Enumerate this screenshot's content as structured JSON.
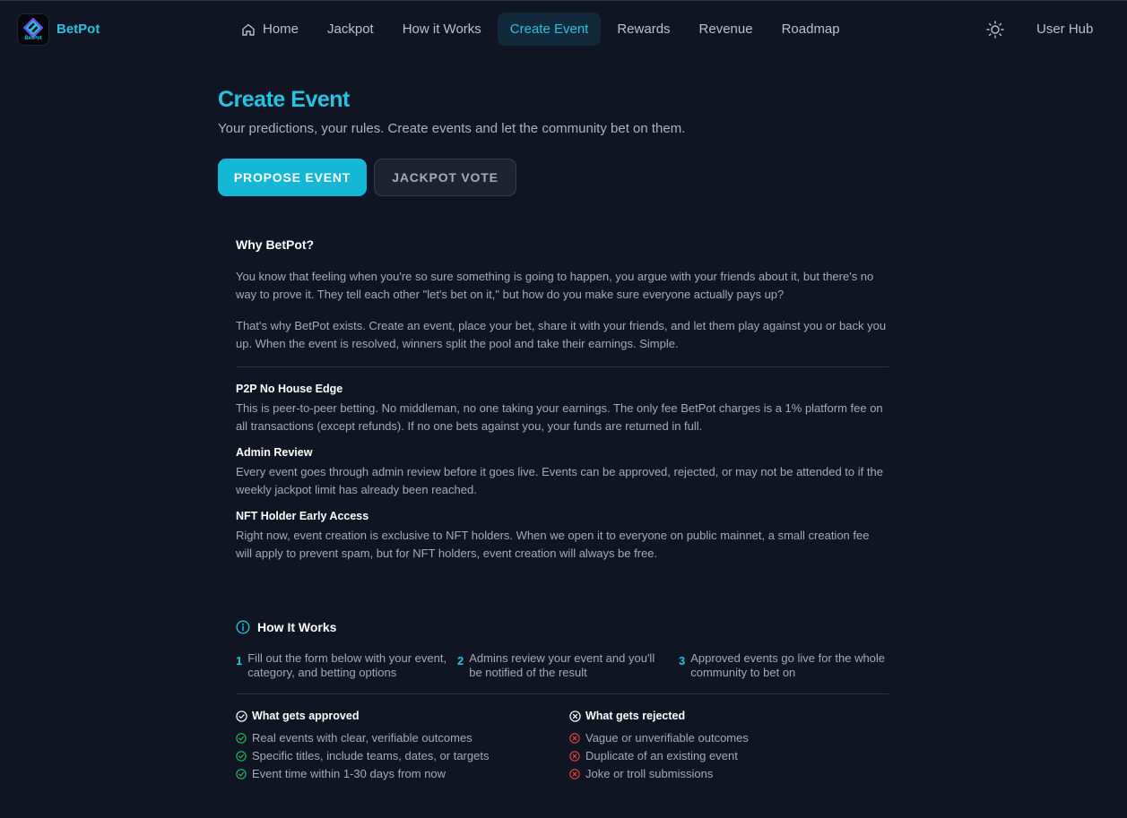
{
  "brand": {
    "name": "BetPot",
    "logo_text": "BetPot"
  },
  "nav": {
    "items": [
      {
        "label": "Home",
        "icon": "home-icon"
      },
      {
        "label": "Jackpot"
      },
      {
        "label": "How it Works"
      },
      {
        "label": "Create Event",
        "active": true
      },
      {
        "label": "Rewards"
      },
      {
        "label": "Revenue"
      },
      {
        "label": "Roadmap"
      }
    ],
    "theme_icon": "sun-icon",
    "user_hub": "User Hub"
  },
  "page": {
    "title": "Create Event",
    "subtitle": "Your predictions, your rules. Create events and let the community bet on them."
  },
  "actions": {
    "propose": "PROPOSE EVENT",
    "jackpot_vote": "JACKPOT VOTE"
  },
  "why": {
    "title": "Why BetPot?",
    "p1": "You know that feeling when you're so sure something is going to happen, you argue with your friends about it, but there's no way to prove it. They tell each other \"let's bet on it,\" but how do you make sure everyone actually pays up?",
    "p2": "That's why BetPot exists. Create an event, place your bet, share it with your friends, and let them play against you or back you up. When the event is resolved, winners split the pool and take their earnings. Simple."
  },
  "features": [
    {
      "title": "P2P No House Edge",
      "text": "This is peer-to-peer betting. No middleman, no one taking your earnings. The only fee BetPot charges is a 1% platform fee on all transactions (except refunds). If no one bets against you, your funds are returned in full."
    },
    {
      "title": "Admin Review",
      "text": "Every event goes through admin review before it goes live. Events can be approved, rejected, or may not be attended to if the weekly jackpot limit has already been reached."
    },
    {
      "title": "NFT Holder Early Access",
      "text": "Right now, event creation is exclusive to NFT holders. When we open it to everyone on public mainnet, a small creation fee will apply to prevent spam, but for NFT holders, event creation will always be free."
    }
  ],
  "how_it_works": {
    "title": "How It Works",
    "steps": [
      {
        "num": "1",
        "text": "Fill out the form below with your event, category, and betting options"
      },
      {
        "num": "2",
        "text": "Admins review your event and you'll be notified of the result"
      },
      {
        "num": "3",
        "text": "Approved events go live for the whole community to bet on"
      }
    ]
  },
  "approved": {
    "title": "What gets approved",
    "items": [
      "Real events with clear, verifiable outcomes",
      "Specific titles, include teams, dates, or targets",
      "Event time within 1-30 days from now"
    ]
  },
  "rejected": {
    "title": "What gets rejected",
    "items": [
      "Vague or unverifiable outcomes",
      "Duplicate of an existing event",
      "Joke or troll submissions"
    ]
  },
  "colors": {
    "accent": "#22c4e0",
    "background": "#0f1523",
    "approve": "#22c55e",
    "reject": "#ef4444"
  }
}
